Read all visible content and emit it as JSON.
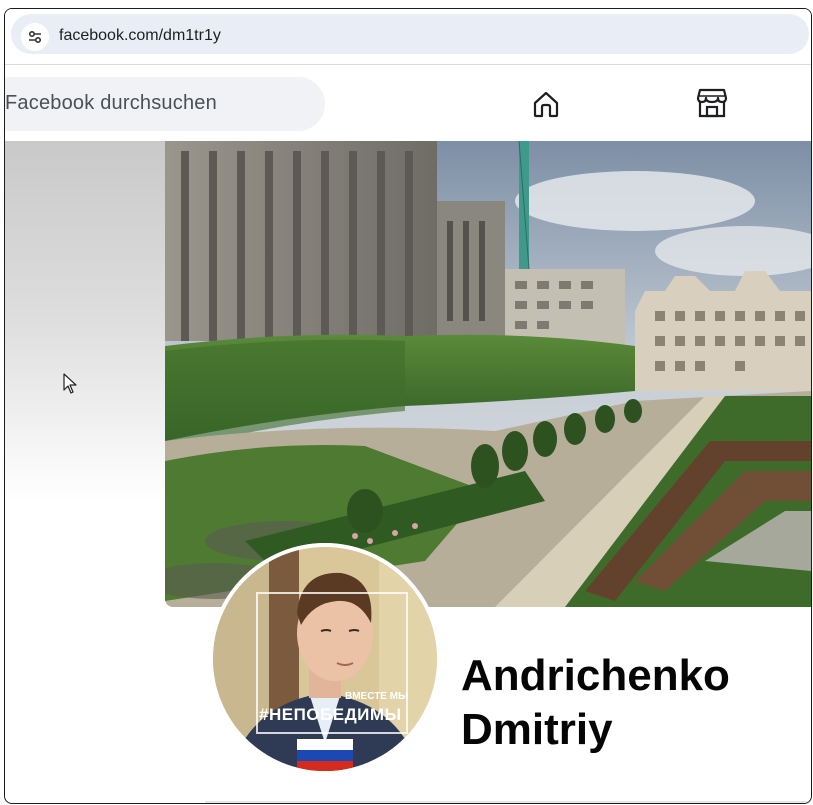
{
  "browser": {
    "url": "facebook.com/dm1tr1y",
    "site_info_icon": "tune-icon"
  },
  "header": {
    "search_placeholder": "Facebook durchsuchen",
    "nav": [
      {
        "name": "home",
        "icon": "home-icon"
      },
      {
        "name": "marketplace",
        "icon": "marketplace-icon"
      }
    ]
  },
  "cover": {
    "description_icon": "cover-photo"
  },
  "profile": {
    "name_line1": "Andrichenko",
    "name_line2": "Dmitriy",
    "avatar_slogan": "#НЕПОБЕДИМЫ",
    "avatar_small_text": "ВМЕСТЕ МЫ"
  },
  "colors": {
    "fb_bg": "#f0f2f5",
    "address_bar": "#e9edf6",
    "text_dark": "#050505"
  }
}
